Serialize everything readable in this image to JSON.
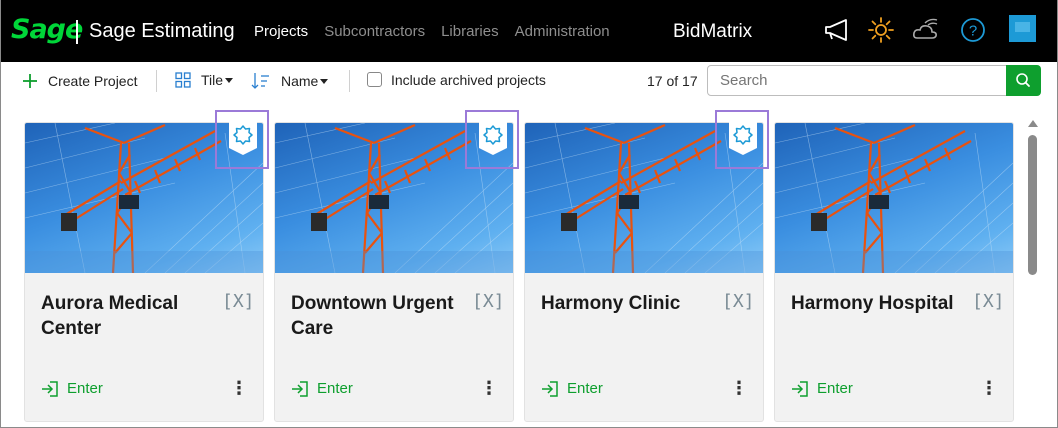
{
  "header": {
    "logo": "Sage",
    "app_name": "Sage Estimating",
    "nav": [
      {
        "label": "Projects",
        "active": true
      },
      {
        "label": "Subcontractors",
        "active": false
      },
      {
        "label": "Libraries",
        "active": false
      },
      {
        "label": "Administration",
        "active": false
      }
    ],
    "product": "BidMatrix",
    "icons": [
      "megaphone-icon",
      "sun-icon",
      "weather-icon",
      "help-icon",
      "app-tile-icon"
    ],
    "colors": {
      "brand_green": "#00d639",
      "accent_blue": "#1d9ad6",
      "sun_orange": "#f0a020"
    }
  },
  "toolbar": {
    "create_label": "Create Project",
    "view_label": "Tile",
    "sort_label": "Name",
    "archived_label": "Include archived projects",
    "archived_checked": false,
    "count_label": "17 of 17",
    "search_placeholder": "Search"
  },
  "cards": [
    {
      "title": "Aurora Medical Center",
      "x_badge": "[X]",
      "enter": "Enter",
      "has_badge": true
    },
    {
      "title": "Downtown Urgent Care",
      "x_badge": "[X]",
      "enter": "Enter",
      "has_badge": true
    },
    {
      "title": "Harmony Clinic",
      "x_badge": "[X]",
      "enter": "Enter",
      "has_badge": true
    },
    {
      "title": "Harmony Hospital",
      "x_badge": "[X]",
      "enter": "Enter",
      "has_badge": false
    }
  ],
  "colors": {
    "enter_green": "#0e9f2e",
    "badge_outline": "#9b7ad8"
  }
}
